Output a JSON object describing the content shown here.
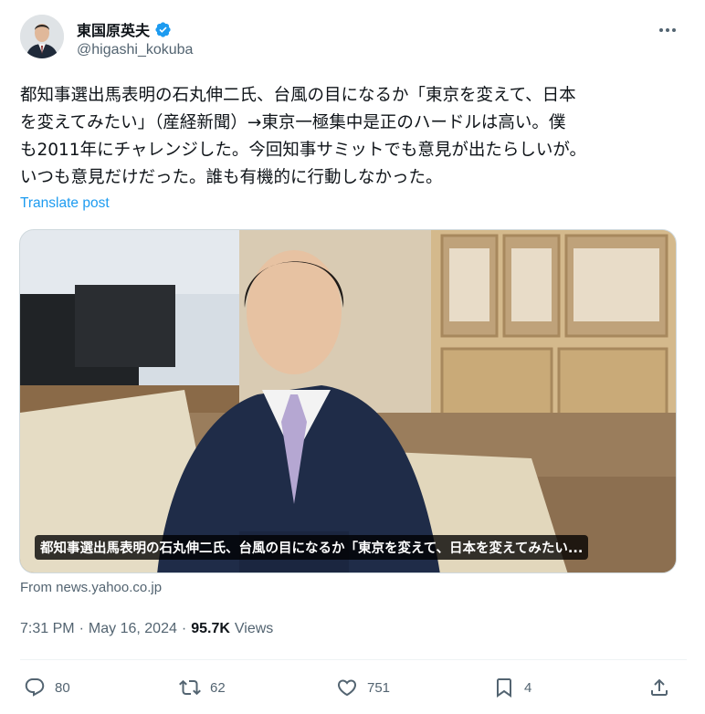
{
  "author": {
    "name": "東国原英夫",
    "handle": "@higashi_kokuba",
    "verified": true
  },
  "tweet": {
    "text": "都知事選出馬表明の石丸伸二氏、台風の目になるか「東京を変えて、日本\nを変えてみたい」（産経新聞）→東京一極集中是正のハードルは高い。僕\nも2011年にチャレンジした。今回知事サミットでも意見が出たらしいが。\nいつも意見だけだった。誰も有機的に行動しなかった。",
    "translate_label": "Translate post"
  },
  "card": {
    "caption": "都知事選出馬表明の石丸伸二氏、台風の目になるか「東京を変えて、日本を変えてみたい...",
    "source": "From news.yahoo.co.jp"
  },
  "meta": {
    "time": "7:31 PM",
    "separator1": "·",
    "date": "May 16, 2024",
    "separator2": "·",
    "views_count": "95.7K",
    "views_label": "Views"
  },
  "actions": {
    "replies": "80",
    "reposts": "62",
    "likes": "751",
    "bookmarks": "4"
  },
  "colors": {
    "accent": "#1d9bf0",
    "secondary_text": "#536471",
    "primary_text": "#0f1419"
  }
}
